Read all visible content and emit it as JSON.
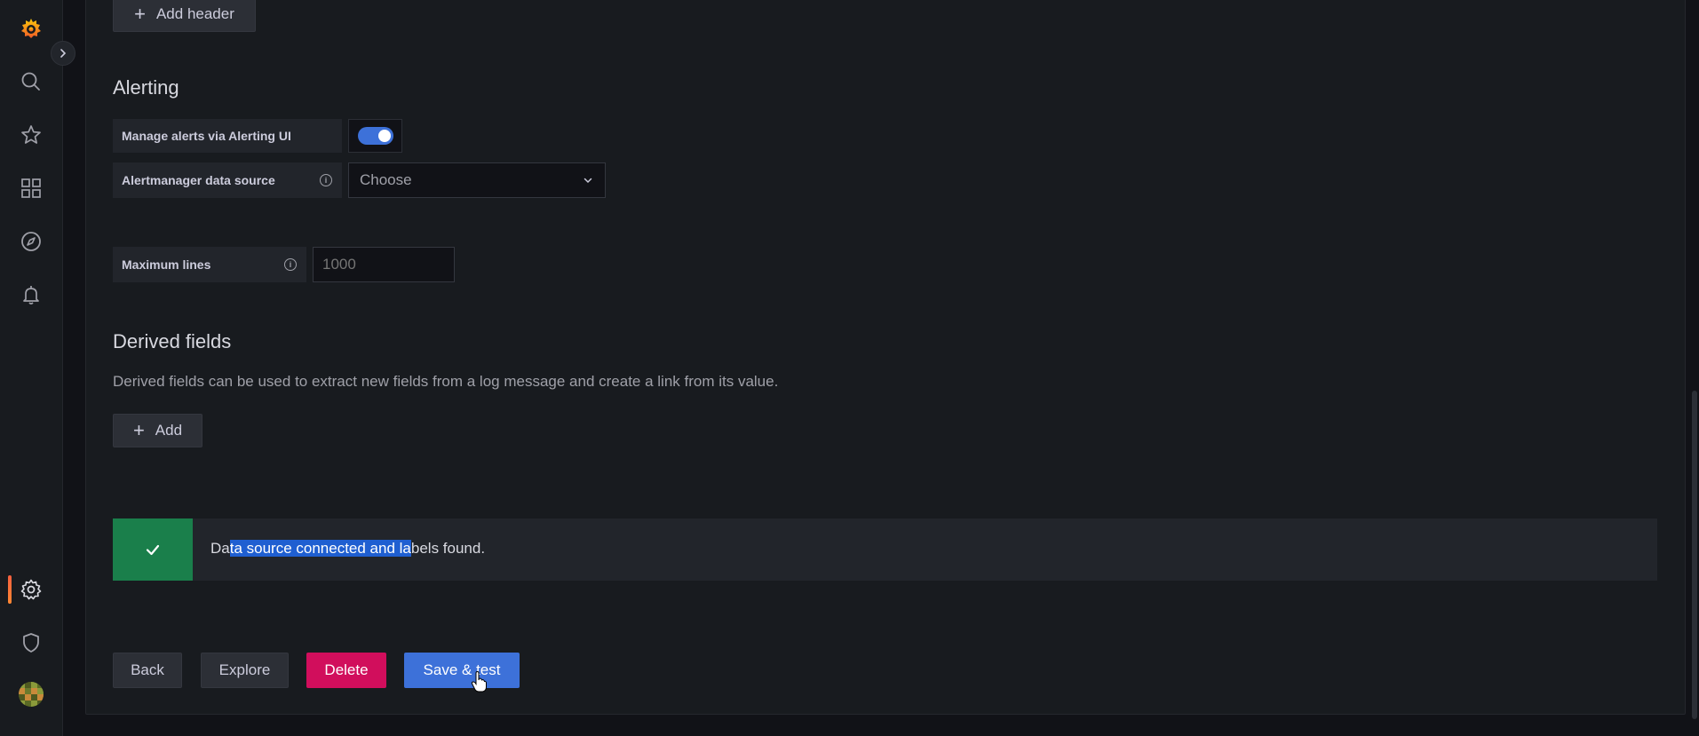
{
  "sidebar": {
    "icons": [
      "grafana-logo-icon",
      "search-icon",
      "star-icon",
      "dashboards-icon",
      "explore-icon",
      "alerting-bell-icon",
      "configuration-gear-icon",
      "server-admin-shield-icon"
    ],
    "active_item": "configuration-gear-icon"
  },
  "headers": {
    "add_header_label": "Add header"
  },
  "alerting": {
    "title": "Alerting",
    "manage_alerts_label": "Manage alerts via Alerting UI",
    "manage_alerts_enabled": true,
    "alertmanager_label": "Alertmanager data source",
    "alertmanager_placeholder": "Choose"
  },
  "max_lines": {
    "label": "Maximum lines",
    "placeholder": "1000"
  },
  "derived_fields": {
    "title": "Derived fields",
    "description": "Derived fields can be used to extract new fields from a log message and create a link from its value.",
    "add_label": "Add"
  },
  "status_alert": {
    "text_before": "Da",
    "text_selected": "ta source connected and la",
    "text_after": "bels found.",
    "status": "success"
  },
  "actions": {
    "back_label": "Back",
    "explore_label": "Explore",
    "delete_label": "Delete",
    "save_test_label": "Save & test"
  },
  "colors": {
    "background": "#111217",
    "panel": "#181b1f",
    "primary": "#3d71d9",
    "danger": "#d10e5c",
    "success": "#1a7f4b",
    "selection": "#1f5fd1"
  }
}
